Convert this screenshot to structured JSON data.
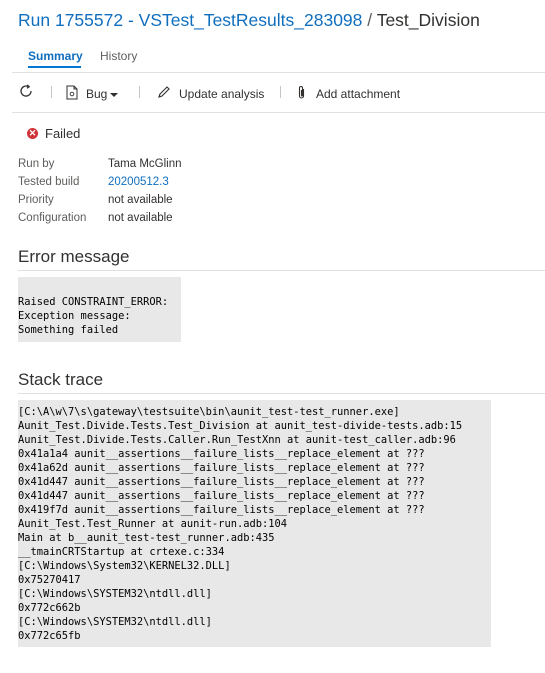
{
  "header": {
    "run_link": "Run 1755572 - VSTest_TestResults_283098",
    "separator": "/",
    "test_name": "Test_Division"
  },
  "tabs": [
    {
      "label": "Summary",
      "active": true
    },
    {
      "label": "History",
      "active": false
    }
  ],
  "toolbar": {
    "refresh_icon": "refresh-icon",
    "bug_label": "Bug",
    "update_analysis_label": "Update analysis",
    "add_attachment_label": "Add attachment"
  },
  "status": {
    "label": "Failed",
    "color": "#d13438"
  },
  "details": {
    "run_by_label": "Run by",
    "run_by_value": "Tama McGlinn",
    "tested_build_label": "Tested build",
    "tested_build_value": "20200512.3",
    "priority_label": "Priority",
    "priority_value": "not available",
    "configuration_label": "Configuration",
    "configuration_value": "not available"
  },
  "error_message": {
    "title": "Error message",
    "lines": [
      "Raised CONSTRAINT_ERROR:",
      "Exception message:",
      "Something failed"
    ]
  },
  "stack_trace": {
    "title": "Stack trace",
    "lines": [
      "[C:\\A\\w\\7\\s\\gateway\\testsuite\\bin\\aunit_test-test_runner.exe]",
      "Aunit_Test.Divide.Tests.Test_Division at aunit_test-divide-tests.adb:15",
      "Aunit_Test.Divide.Tests.Caller.Run_TestXnn at aunit-test_caller.adb:96",
      "0x41a1a4 aunit__assertions__failure_lists__replace_element at ???",
      "0x41a62d aunit__assertions__failure_lists__replace_element at ???",
      "0x41d447 aunit__assertions__failure_lists__replace_element at ???",
      "0x41d447 aunit__assertions__failure_lists__replace_element at ???",
      "0x419f7d aunit__assertions__failure_lists__replace_element at ???",
      "Aunit_Test.Test_Runner at aunit-run.adb:104",
      "Main at b__aunit_test-test_runner.adb:435",
      "__tmainCRTStartup at crtexe.c:334",
      "[C:\\Windows\\System32\\KERNEL32.DLL]",
      "0x75270417",
      "[C:\\Windows\\SYSTEM32\\ntdll.dll]",
      "0x772c662b",
      "[C:\\Windows\\SYSTEM32\\ntdll.dll]",
      "0x772c65fb"
    ]
  },
  "colors": {
    "link": "#106ebe",
    "accent": "#0078d4",
    "failed": "#d13438",
    "code_bg": "#e8e8e8"
  }
}
